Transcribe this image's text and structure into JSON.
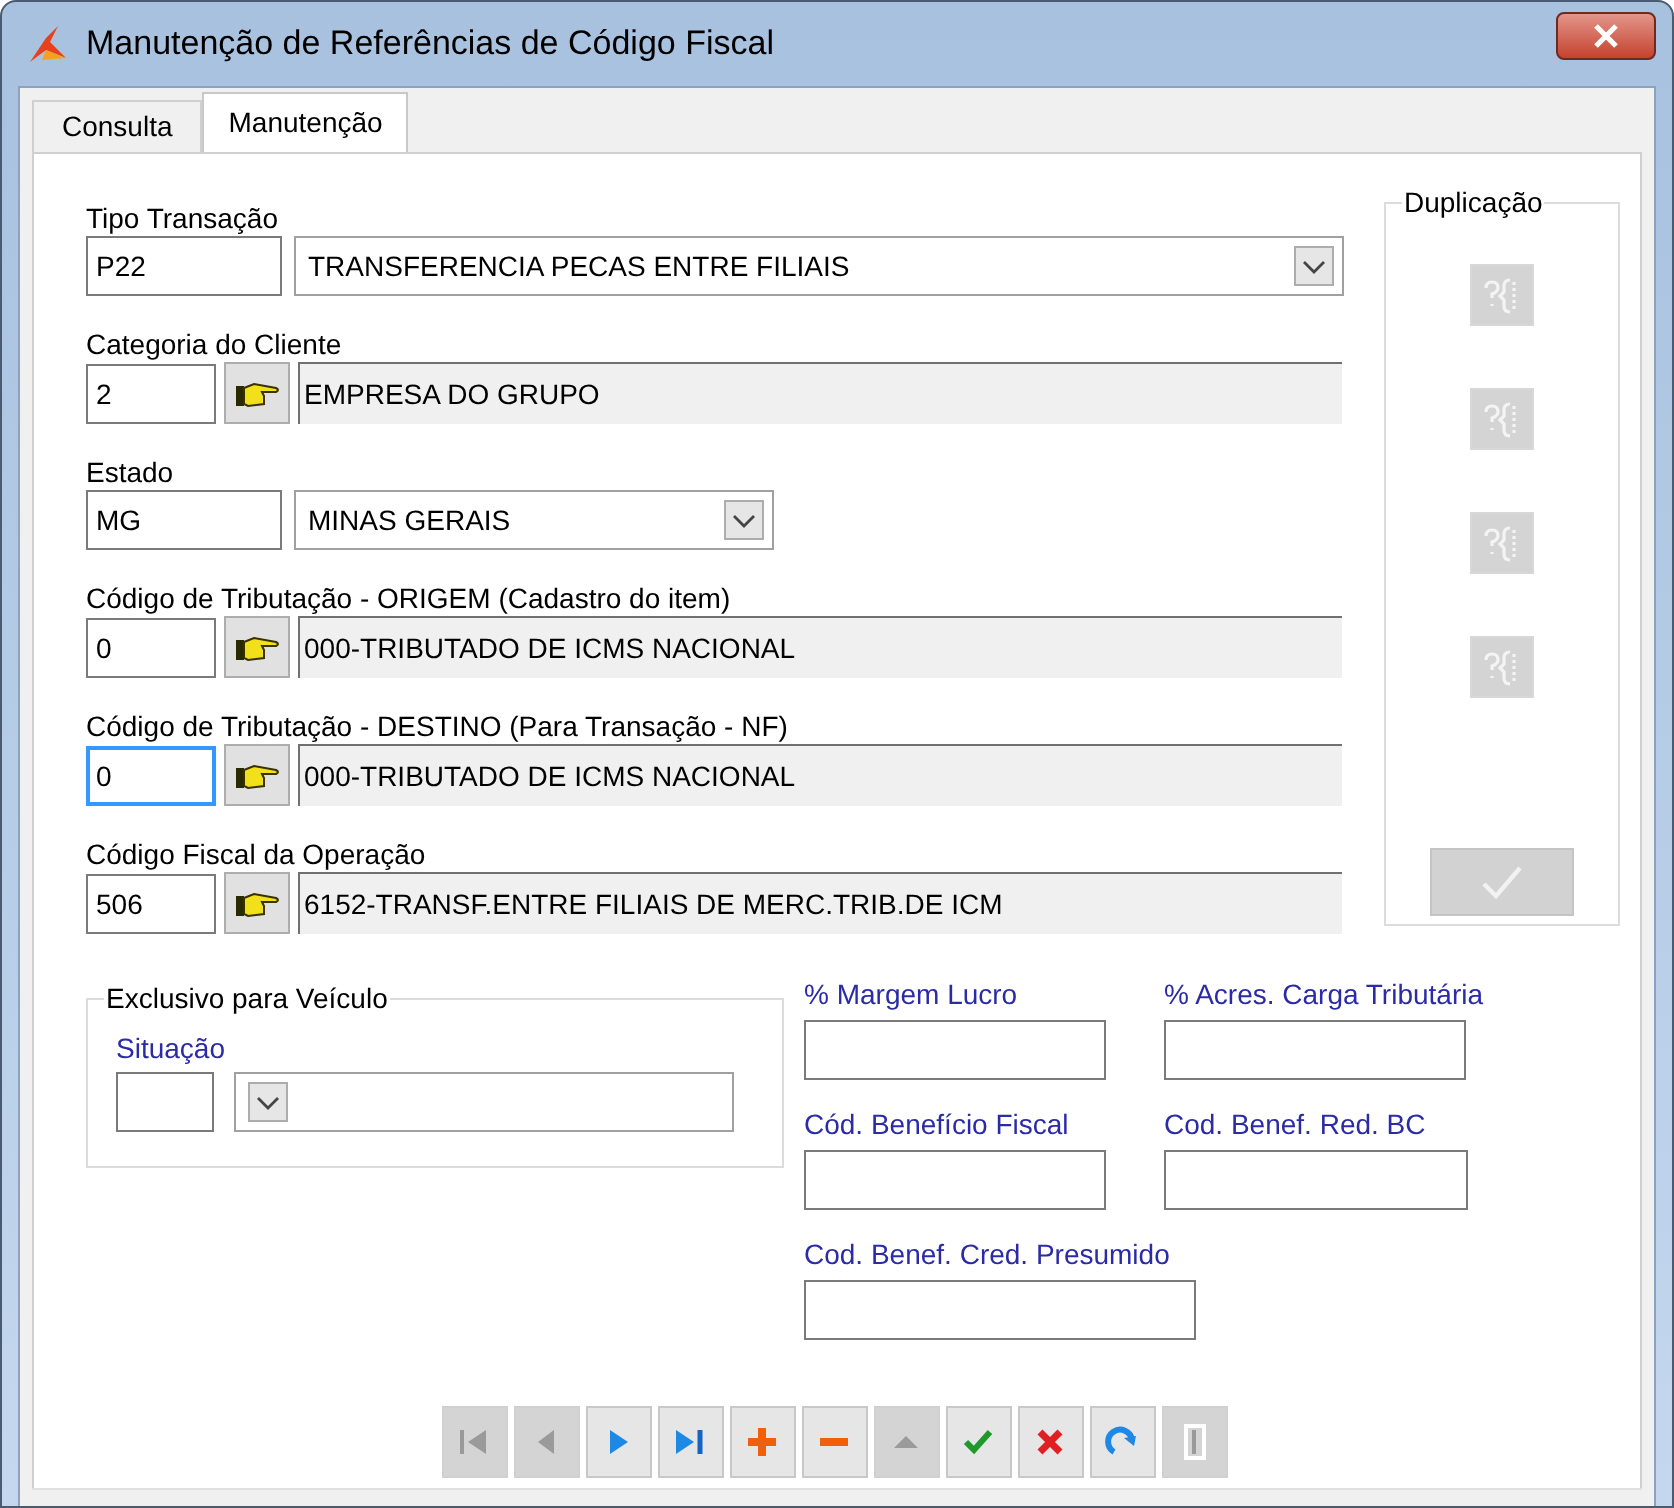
{
  "window": {
    "title": "Manutenção de Referências de Código Fiscal"
  },
  "tabs": [
    {
      "label": "Consulta",
      "selected": false
    },
    {
      "label": "Manutenção",
      "selected": true
    }
  ],
  "fields": [
    {
      "kind": "combo",
      "label": "Tipo Transação",
      "code": "P22",
      "value": "TRANSFERENCIA PECAS ENTRE FILIAIS",
      "focused": false
    },
    {
      "kind": "lookup",
      "label": "Categoria do Cliente",
      "code": "2",
      "value": "EMPRESA DO GRUPO",
      "focused": false
    },
    {
      "kind": "combo-short",
      "label": "Estado",
      "code": "MG",
      "value": "MINAS GERAIS",
      "focused": false
    },
    {
      "kind": "lookup",
      "label": "Código de Tributação - ORIGEM (Cadastro do item)",
      "code": "0",
      "value": "000-TRIBUTADO DE ICMS NACIONAL",
      "focused": false
    },
    {
      "kind": "lookup",
      "label": "Código de Tributação - DESTINO (Para Transação - NF)",
      "code": "0",
      "value": "000-TRIBUTADO DE ICMS NACIONAL",
      "focused": true
    },
    {
      "kind": "lookup",
      "label": "Código Fiscal da Operação",
      "code": "506",
      "value": "6152-TRANSF.ENTRE FILIAIS DE MERC.TRIB.DE ICM",
      "focused": false
    }
  ],
  "duplication": {
    "title": "Duplicação",
    "buttons": [
      {
        "disabled": true
      },
      {
        "disabled": true
      },
      {
        "disabled": true
      },
      {
        "disabled": true
      }
    ],
    "confirm": {
      "disabled": true
    }
  },
  "vehicle": {
    "title": "Exclusivo para Veículo",
    "label": "Situação"
  },
  "extra_fields": [
    {
      "label": "% Margem Lucro"
    },
    {
      "label": "% Acres. Carga Tributária"
    },
    {
      "label": "Cód. Benefício Fiscal"
    },
    {
      "label": "Cod. Benef. Red. BC"
    },
    {
      "label": "Cod. Benef. Cred. Presumido"
    }
  ],
  "toolbar": [
    {
      "kind": "first",
      "disabled": true
    },
    {
      "kind": "prev",
      "disabled": true
    },
    {
      "kind": "next",
      "disabled": false
    },
    {
      "kind": "last",
      "disabled": false
    },
    {
      "kind": "add",
      "disabled": false
    },
    {
      "kind": "remove",
      "disabled": false
    },
    {
      "kind": "up",
      "disabled": true
    },
    {
      "kind": "save",
      "disabled": false
    },
    {
      "kind": "cancel",
      "disabled": false
    },
    {
      "kind": "refresh",
      "disabled": false
    },
    {
      "kind": "exit",
      "disabled": true
    }
  ]
}
